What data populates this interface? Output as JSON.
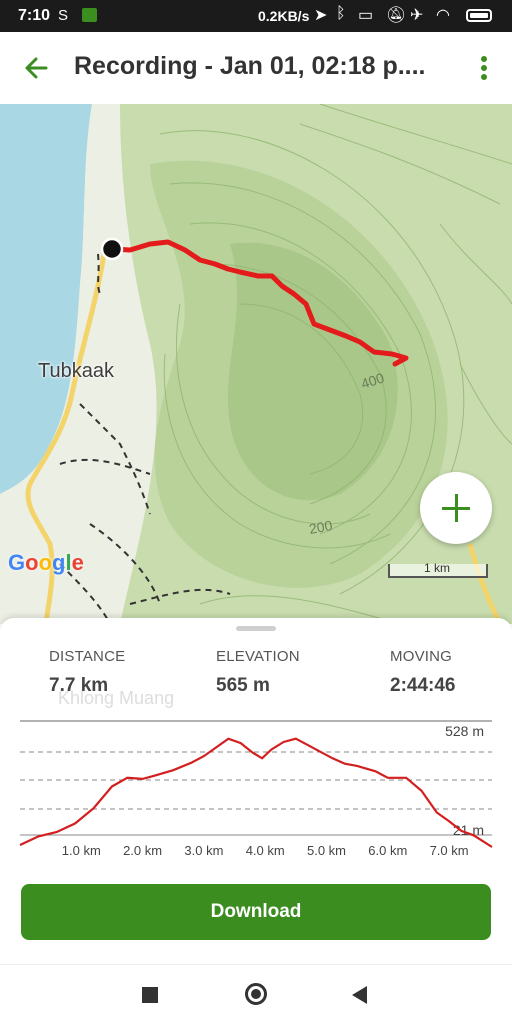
{
  "status_bar": {
    "time": "7:10",
    "network_speed": "0.2KB/s"
  },
  "app_bar": {
    "title": "Recording - Jan 01, 02:18 p...."
  },
  "map": {
    "place_label": "Tubkaak",
    "contour_labels": [
      "400",
      "200"
    ],
    "scale_label": "1 km",
    "attribution": "Google",
    "route_color": "#e31b1b",
    "accent_color": "#3b8d1f"
  },
  "stats": {
    "distance": {
      "label": "DISTANCE",
      "value": "7.7 km"
    },
    "elevation": {
      "label": "ELEVATION",
      "value": "565 m"
    },
    "moving": {
      "label": "MOVING",
      "value": "2:44:46"
    }
  },
  "underlay_text": "Khlong Muang",
  "chart_data": {
    "type": "line",
    "x_unit": "km",
    "y_unit": "m",
    "xlabel": "",
    "ylabel": "",
    "x_ticks": [
      "1.0 km",
      "2.0 km",
      "3.0 km",
      "4.0 km",
      "5.0 km",
      "6.0 km",
      "7.0 km"
    ],
    "y_labels": {
      "max": "528 m",
      "min": "21 m"
    },
    "xlim": [
      0,
      7.7
    ],
    "ylim": [
      21,
      528
    ],
    "grid": true,
    "series": [
      {
        "color": "#d31f1f",
        "x": [
          0,
          0.3,
          0.6,
          0.9,
          1.2,
          1.5,
          1.75,
          2.0,
          2.2,
          2.5,
          2.8,
          3.0,
          3.2,
          3.4,
          3.6,
          3.8,
          3.95,
          4.1,
          4.3,
          4.5,
          4.7,
          4.9,
          5.1,
          5.3,
          5.5,
          5.8,
          6.0,
          6.3,
          6.55,
          6.8,
          7.0,
          7.2,
          7.4,
          7.7
        ],
        "y": [
          30,
          70,
          90,
          130,
          200,
          300,
          340,
          335,
          350,
          375,
          410,
          440,
          480,
          520,
          500,
          455,
          430,
          470,
          505,
          520,
          490,
          460,
          430,
          405,
          395,
          370,
          340,
          340,
          280,
          180,
          140,
          95,
          75,
          21
        ]
      }
    ]
  },
  "download_label": "Download"
}
